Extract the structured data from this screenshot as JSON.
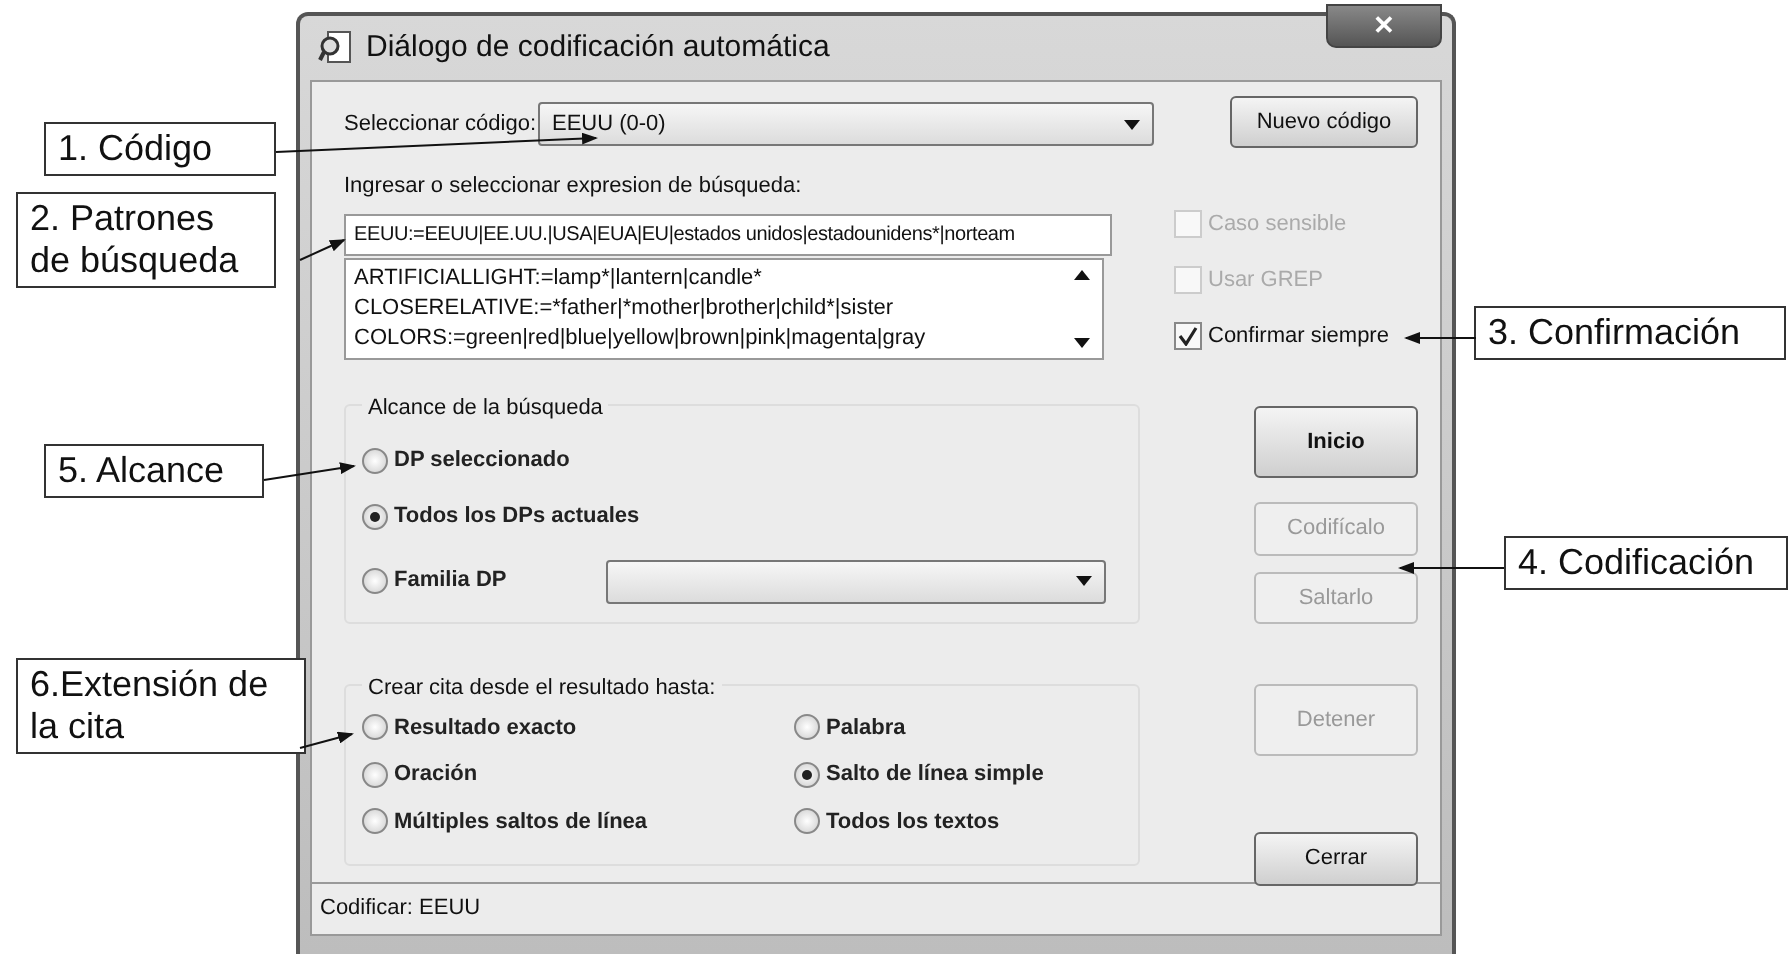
{
  "window": {
    "title": "Diálogo de codificación automática",
    "close": "✕"
  },
  "code_select": {
    "label": "Seleccionar código:",
    "value": "EEUU (0-0)"
  },
  "new_code_button": "Nuevo código",
  "search": {
    "label": "Ingresar o seleccionar expresion de búsqueda:",
    "value": "EEUU:=EEUU|EE.UU.|USA|EUA|EU|estados unidos|estadounidens*|norteam"
  },
  "pattern_list": [
    "ARTIFICIALLIGHT:=lamp*|lantern|candle*",
    "CLOSERELATIVE:=*father|*mother|brother|child*|sister",
    "COLORS:=green|red|blue|yellow|brown|pink|magenta|gray"
  ],
  "options": [
    {
      "label": "Caso sensible",
      "checked": false,
      "disabled": true
    },
    {
      "label": "Usar GREP",
      "checked": false,
      "disabled": true
    },
    {
      "label": "Confirmar siempre",
      "checked": true,
      "disabled": false
    }
  ],
  "scope": {
    "title": "Alcance de la búsqueda",
    "options": [
      {
        "label": "DP seleccionado",
        "selected": false
      },
      {
        "label": "Todos los DPs actuales",
        "selected": true
      },
      {
        "label": "Familia DP",
        "selected": false
      }
    ]
  },
  "quote_extent": {
    "title": "Crear cita desde el resultado hasta:",
    "options": [
      {
        "label": "Resultado exacto",
        "selected": false
      },
      {
        "label": "Palabra",
        "selected": false
      },
      {
        "label": "Oración",
        "selected": false
      },
      {
        "label": "Salto de línea simple",
        "selected": true
      },
      {
        "label": "Múltiples saltos de línea",
        "selected": false
      },
      {
        "label": "Todos los textos",
        "selected": false
      }
    ]
  },
  "buttons": [
    {
      "label": "Inicio",
      "disabled": false
    },
    {
      "label": "Codifícalo",
      "disabled": true
    },
    {
      "label": "Saltarlo",
      "disabled": true
    },
    {
      "label": "Detener",
      "disabled": true
    },
    {
      "label": "Cerrar",
      "disabled": false
    }
  ],
  "status_bar": "Codificar: EEUU",
  "callouts": [
    {
      "label": "1. Código"
    },
    {
      "label": "2. Patrones de búsqueda"
    },
    {
      "label": "3. Confirmación"
    },
    {
      "label": "4. Codificación"
    },
    {
      "label": "5. Alcance"
    },
    {
      "label": "6.Extensión de la cita"
    }
  ]
}
